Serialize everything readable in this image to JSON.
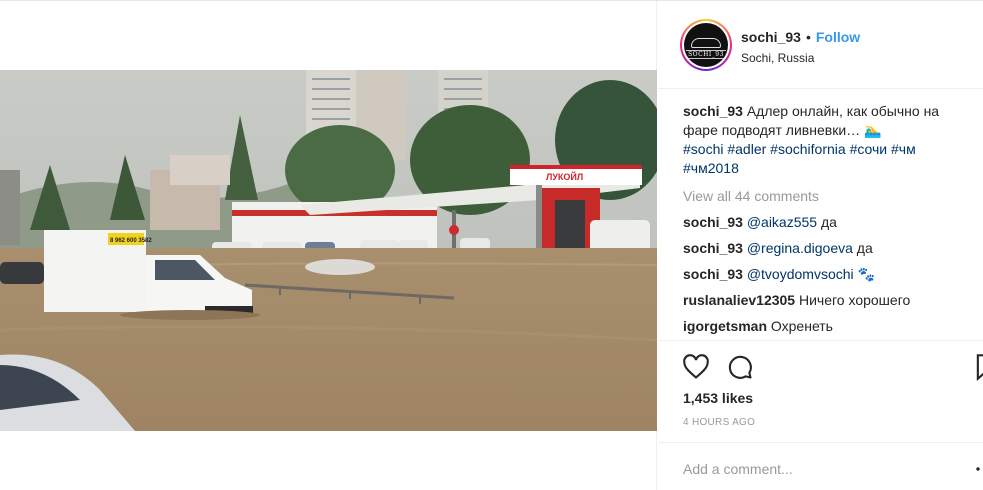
{
  "post": {
    "username": "sochi_93",
    "bullet": "•",
    "follow_label": "Follow",
    "location": "Sochi, Russia",
    "avatar_text": "SOCHI_93",
    "caption": {
      "username": "sochi_93",
      "text": "Адлер онлайн, как обычно на фаре подводят ливневки… 🏊‍♂️",
      "hashtags": [
        "#sochi",
        "#adler",
        "#sochifornia",
        "#сочи",
        "#чм",
        "#чм2018"
      ]
    },
    "view_all": "View all 44 comments",
    "comments": [
      {
        "user": "sochi_93",
        "mention": "@aikaz555",
        "text": "да"
      },
      {
        "user": "sochi_93",
        "mention": "@regina.digoeva",
        "text": "да"
      },
      {
        "user": "sochi_93",
        "mention": "@tvoydomvsochi",
        "text": "🐾"
      },
      {
        "user": "ruslanaliev12305",
        "mention": "",
        "text": "Ничего хорошего"
      },
      {
        "user": "igorgetsman",
        "mention": "",
        "text": "Охренеть"
      }
    ],
    "likes": "1,453 likes",
    "timestamp": "4 HOURS AGO",
    "add_comment_placeholder": "Add a comment...",
    "carousel": {
      "count": 4,
      "active": 1
    },
    "photo_text": {
      "sign": "ЛУКОЙЛ",
      "truck_phone": "8 962 600 3582"
    }
  },
  "colors": {
    "link": "#3897f0",
    "hashtag": "#003569",
    "muted": "#999999"
  }
}
